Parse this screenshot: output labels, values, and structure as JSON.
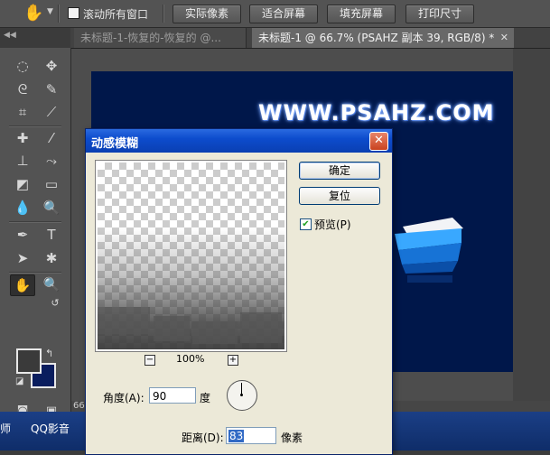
{
  "options_bar": {
    "scroll_all_windows_label": "滚动所有窗口",
    "buttons": [
      "实际像素",
      "适合屏幕",
      "填充屏幕",
      "打印尺寸"
    ]
  },
  "tabs": [
    {
      "label": "未标题-1-恢复的-恢复的 @...",
      "active": false
    },
    {
      "label": "未标题-1 @ 66.7% (PSAHZ 副本 39, RGB/8) *",
      "active": true
    }
  ],
  "document": {
    "watermark": "WWW.PSAHZ.COM",
    "background_color": "#00174a"
  },
  "status": {
    "zoom_fragment": "66"
  },
  "taskbar": {
    "items": [
      "师",
      "QQ影音"
    ]
  },
  "toolbar": {
    "foreground_color": "#3a3a3a",
    "background_color": "#0a1d5e"
  },
  "dialog": {
    "title": "动感模糊",
    "ok_label": "确定",
    "reset_label": "复位",
    "preview_label": "预览(P)",
    "preview_checked": true,
    "zoom": "100%",
    "angle_label": "角度(A):",
    "angle_value": "90",
    "angle_unit": "度",
    "distance_label": "距离(D):",
    "distance_value": "83",
    "distance_unit": "像素"
  }
}
